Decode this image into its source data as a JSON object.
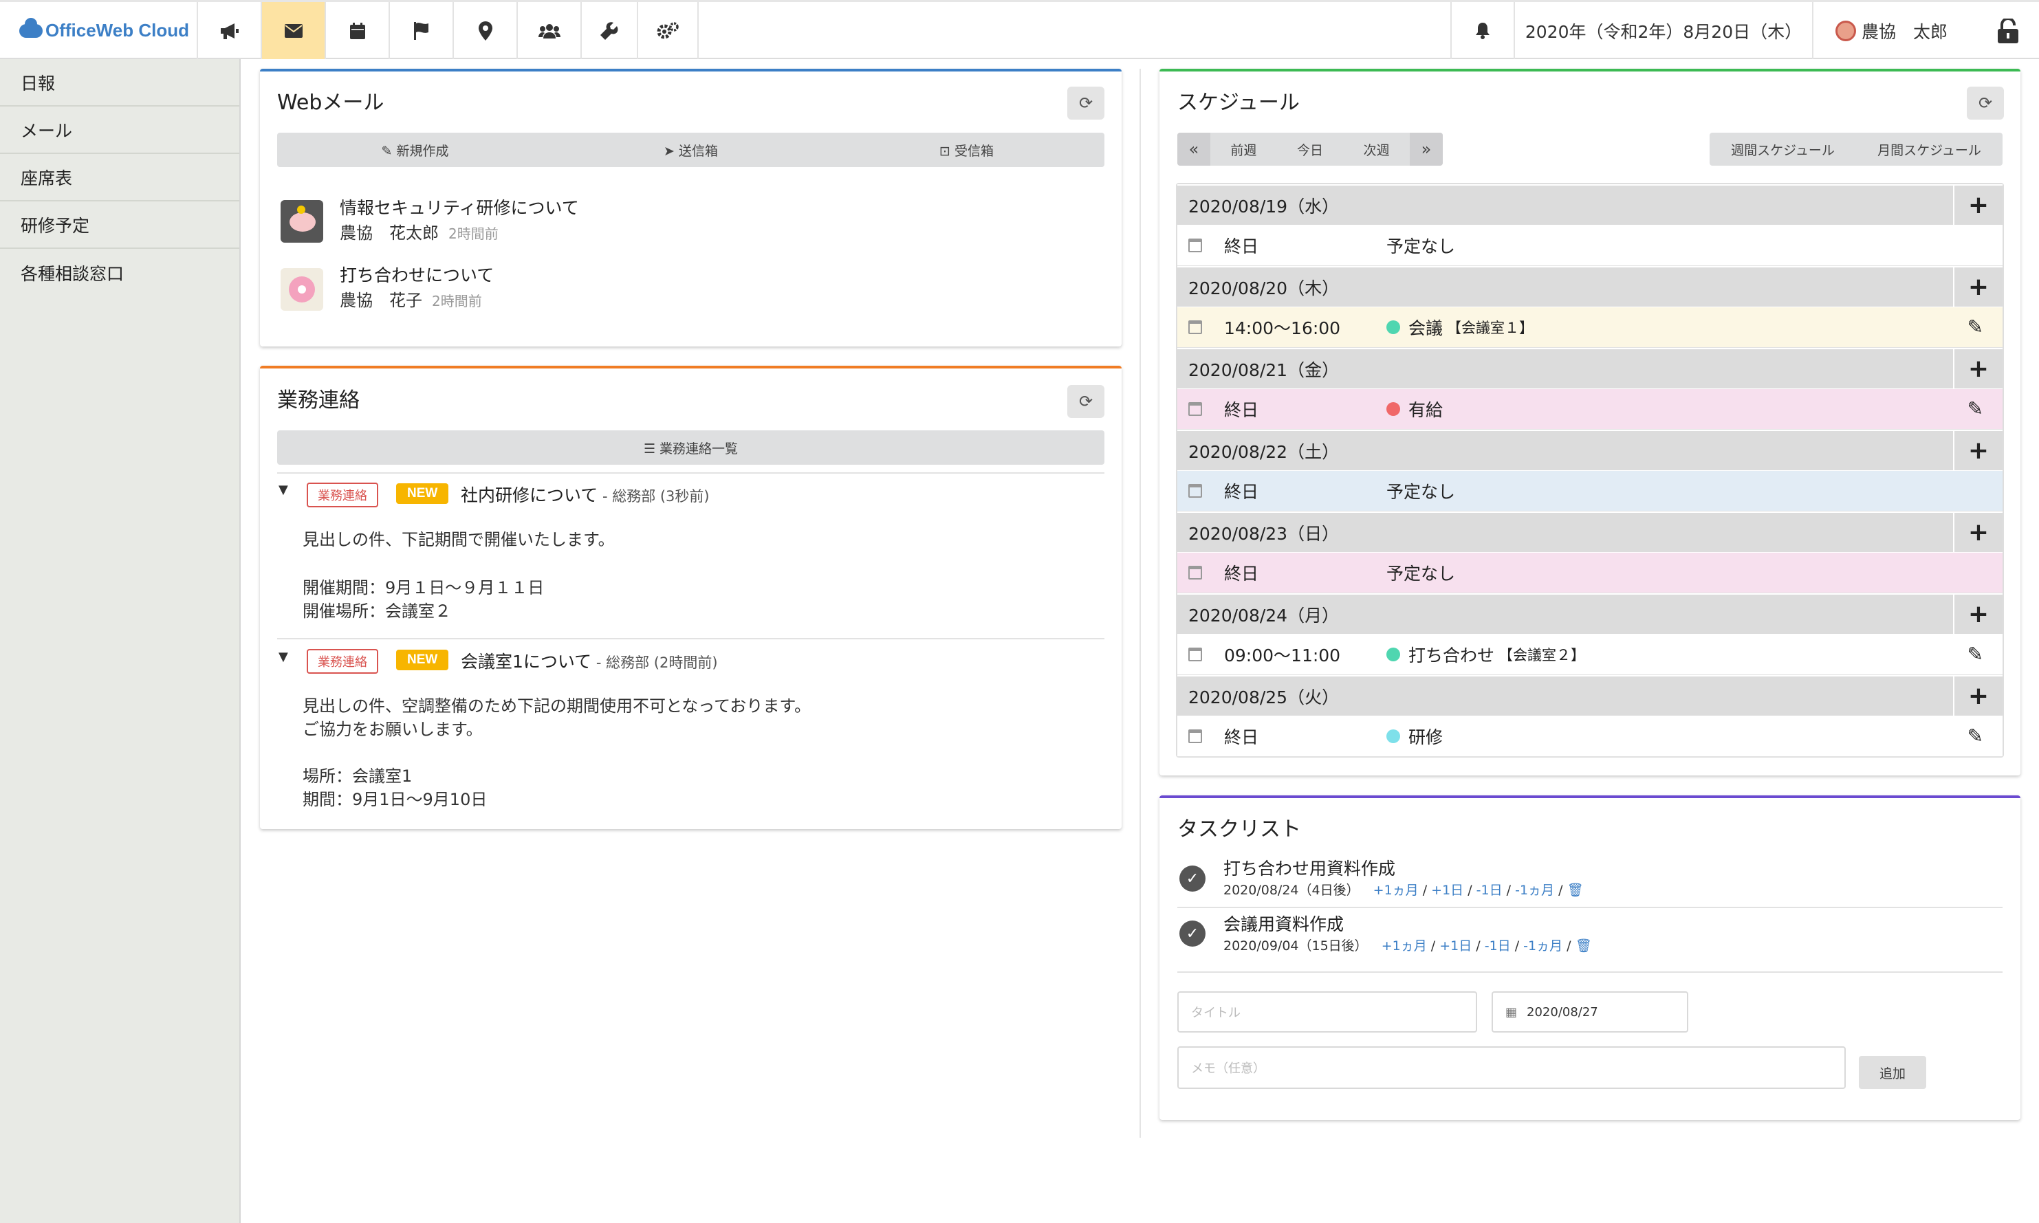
{
  "app": {
    "logo_text": "OfficeWeb Cloud"
  },
  "topbar": {
    "nav_icons": [
      "megaphone-icon",
      "envelope-icon",
      "calendar-icon",
      "flag-icon",
      "map-pin-icon",
      "users-icon",
      "wrench-icon",
      "gears-icon"
    ],
    "active_nav": "envelope-icon",
    "date_text": "2020年（令和2年）8月20日（木）",
    "user_name": "農協　太郎"
  },
  "sidebar": {
    "items": [
      {
        "label": "日報"
      },
      {
        "label": "メール"
      },
      {
        "label": "座席表"
      },
      {
        "label": "研修予定"
      },
      {
        "label": "各種相談窓口"
      }
    ]
  },
  "colors": {
    "webmail_accent": "#3c7fc6",
    "notice_accent": "#f07c24",
    "schedule_accent": "#3cba54",
    "task_accent": "#6a4ad0",
    "active_nav_bg": "#fde3a3"
  },
  "webmail": {
    "title": "Webメール",
    "buttons": {
      "compose": "新規作成",
      "sent": "送信箱",
      "inbox": "受信箱"
    },
    "messages": [
      {
        "subject": "情報セキュリティ研修について",
        "from": "農協　花太郎",
        "time": "2時間前"
      },
      {
        "subject": "打ち合わせについて",
        "from": "農協　花子",
        "time": "2時間前"
      }
    ]
  },
  "notices": {
    "title": "業務連絡",
    "list_button": "業務連絡一覧",
    "items": [
      {
        "badge": "業務連絡",
        "new_label": "NEW",
        "title": "社内研修について",
        "meta": " - 総務部 (3秒前)",
        "lines": [
          "見出しの件、下記期間で開催いたします。",
          "",
          "開催期間：9月１日〜９月１１日",
          "開催場所：会議室２"
        ]
      },
      {
        "badge": "業務連絡",
        "new_label": "NEW",
        "title": "会議室1について",
        "meta": " - 総務部 (2時間前)",
        "lines": [
          "見出しの件、空調整備のため下記の期間使用不可となっております。",
          "ご協力をお願いします。",
          "",
          "場所：会議室1",
          "期間：9月1日〜9月10日"
        ]
      }
    ]
  },
  "schedule": {
    "title": "スケジュール",
    "nav": {
      "prev": "前週",
      "today": "今日",
      "next": "次週"
    },
    "views": {
      "weekly": "週間スケジュール",
      "monthly": "月間スケジュール"
    },
    "days": [
      {
        "date": "2020/08/19（水）",
        "time": "終日",
        "event": "予定なし",
        "room": "",
        "dot": "",
        "bg": "#ffffff",
        "edit": false
      },
      {
        "date": "2020/08/20（木）",
        "time": "14:00〜16:00",
        "event": "会議",
        "room": "【会議室１】",
        "dot": "#4fd6b0",
        "bg": "#fcf7e4",
        "edit": true
      },
      {
        "date": "2020/08/21（金）",
        "time": "終日",
        "event": "有給",
        "room": "",
        "dot": "#f06868",
        "bg": "#f7e0ee",
        "edit": true
      },
      {
        "date": "2020/08/22（土）",
        "time": "終日",
        "event": "予定なし",
        "room": "",
        "dot": "",
        "bg": "#e2ecf5",
        "edit": false
      },
      {
        "date": "2020/08/23（日）",
        "time": "終日",
        "event": "予定なし",
        "room": "",
        "dot": "",
        "bg": "#f7e0ee",
        "edit": false
      },
      {
        "date": "2020/08/24（月）",
        "time": "09:00〜11:00",
        "event": "打ち合わせ",
        "room": "【会議室２】",
        "dot": "#4fd6b0",
        "bg": "#ffffff",
        "edit": true
      },
      {
        "date": "2020/08/25（火）",
        "time": "終日",
        "event": "研修",
        "room": "",
        "dot": "#7ee0ea",
        "bg": "#ffffff",
        "edit": true
      }
    ]
  },
  "tasks": {
    "title": "タスクリスト",
    "items": [
      {
        "title": "打ち合わせ用資料作成",
        "due": "2020/08/24（4日後）"
      },
      {
        "title": "会議用資料作成",
        "due": "2020/09/04（15日後）"
      }
    ],
    "actions": {
      "plus_month": "+1ヵ月",
      "plus_day": "+1日",
      "minus_day": "-1日",
      "minus_month": "-1ヵ月",
      "sep": " / "
    },
    "form": {
      "title_placeholder": "タイトル",
      "date_value": "2020/08/27",
      "memo_placeholder": "メモ（任意）",
      "add_button": "追加"
    }
  }
}
